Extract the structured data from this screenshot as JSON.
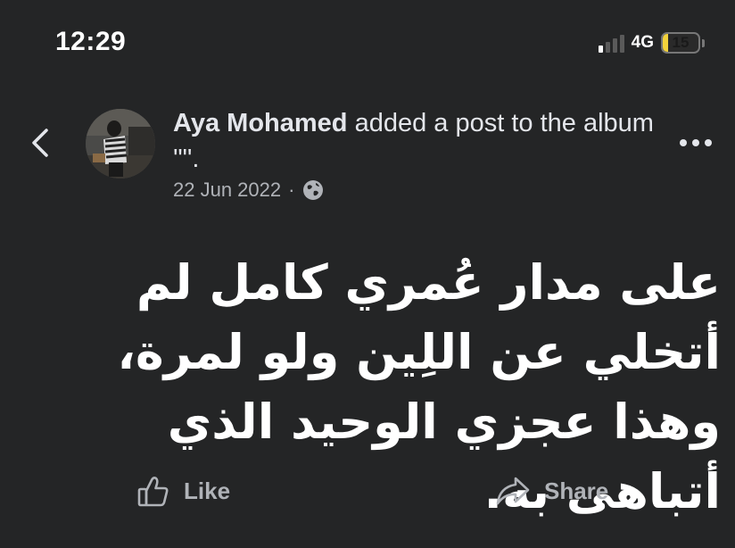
{
  "status_bar": {
    "time": "12:29",
    "network": "4G",
    "battery_level": "15",
    "battery_fraction": 0.15,
    "signal_bars_active": 1,
    "signal_bars_total": 4
  },
  "header": {
    "back_icon": "chevron-left-icon",
    "author": "Aya Mohamed",
    "action_text": " added a post to the album '\"'.",
    "date": "22 Jun 2022",
    "separator": "·",
    "privacy_icon": "globe-icon",
    "more_icon": "ellipsis-icon"
  },
  "post": {
    "text": "على مدار عُمري كامل لم أتخلي عن اللِين ولو لمرة، وهذا عجزي الوحيد الذي أتباهى به."
  },
  "actions": {
    "like_label": "Like",
    "like_icon": "thumbs-up-icon",
    "share_label": "Share",
    "share_icon": "share-arrow-icon"
  },
  "colors": {
    "background": "#242526",
    "text_primary": "#e4e6eb",
    "text_secondary": "#b0b3b8",
    "battery_fill": "#f3d23b"
  }
}
